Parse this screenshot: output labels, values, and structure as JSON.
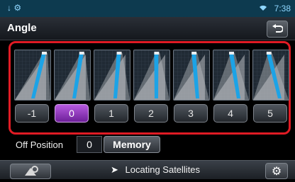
{
  "status": {
    "left_icons": "↓ ⚙",
    "wifi_icon": "wifi-icon",
    "time": "7:38"
  },
  "header": {
    "title": "Angle",
    "back_icon": "back-icon"
  },
  "angle": {
    "selected": "0",
    "options": [
      "-1",
      "0",
      "1",
      "2",
      "3",
      "4",
      "5"
    ]
  },
  "off_position": {
    "label": "Off Position",
    "value": "0",
    "memory_label": "Memory"
  },
  "bottom": {
    "status_text": "Locating Satellites"
  },
  "colors": {
    "frame": "#e01b24",
    "accent": "#b75be0"
  }
}
